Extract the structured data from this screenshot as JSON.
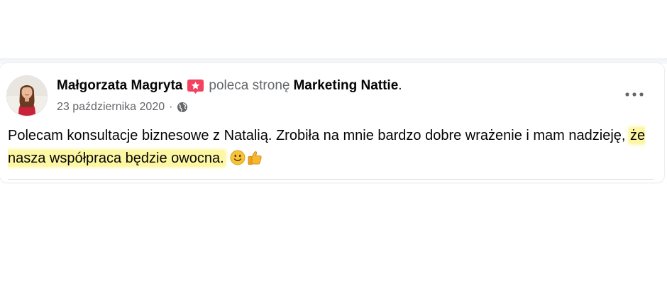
{
  "post": {
    "author": "Małgorzata Magryta",
    "recommends_text": "poleca stronę",
    "page": "Marketing Nattie",
    "period": ".",
    "date": "23 października 2020",
    "dot": "·",
    "audience_icon": "globe-icon",
    "recommendation_icon": "star-recommendation-icon",
    "body_plain": "Polecam konsultacje biznesowe z Natalią. Zrobiła na mnie bardzo dobre wrażenie i mam nadzieję, ",
    "body_highlight": "że nasza współpraca będzie owocna.",
    "emojis": [
      "slightly-smiling-face-emoji",
      "thumbs-up-emoji"
    ],
    "highlight_color": "#fdf7a3",
    "accent_color": "#f3425f",
    "more_label": "more-options-icon"
  }
}
